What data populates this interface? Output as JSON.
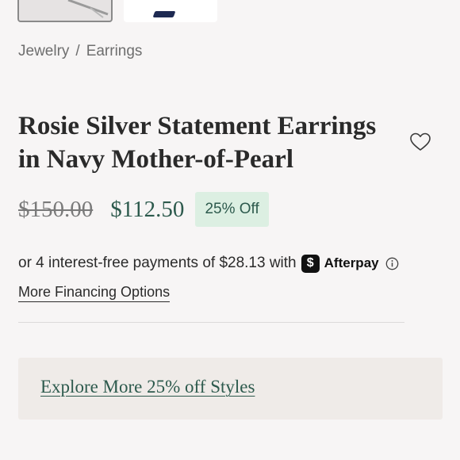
{
  "breadcrumb": {
    "items": [
      "Jewelry",
      "Earrings"
    ],
    "separator": "/"
  },
  "product": {
    "title": "Rosie Silver Statement Earrings in Navy Mother-of-Pearl",
    "original_price": "$150.00",
    "sale_price": "$112.50",
    "discount_badge": "25% Off"
  },
  "financing": {
    "afterpay_text": "or 4 interest-free payments of $28.13 with",
    "afterpay_brand": "Afterpay",
    "afterpay_badge_glyph": "$",
    "more_options_label": "More Financing Options"
  },
  "promo": {
    "explore_label": "Explore More 25% off Styles"
  },
  "icons": {
    "wishlist": "heart-outline-icon",
    "info": "info-circle-icon"
  },
  "colors": {
    "accent_green": "#2d5a4d",
    "badge_bg": "#dcefe2",
    "promo_bg": "#efebe8",
    "page_bg": "#f7f5f5"
  }
}
